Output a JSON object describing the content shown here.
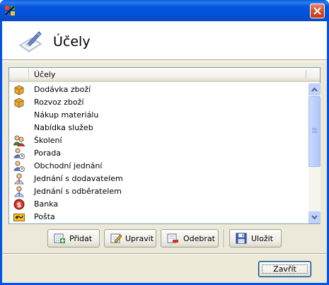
{
  "window": {
    "title": "",
    "close_icon": "close-icon"
  },
  "header": {
    "title": "Účely",
    "icon": "pencil-paper-icon"
  },
  "list": {
    "column": "Účely",
    "items": [
      {
        "label": "Dodávka zboží",
        "icon": "box-icon"
      },
      {
        "label": "Rozvoz zboží",
        "icon": "box-icon"
      },
      {
        "label": "Nákup materiálu",
        "icon": ""
      },
      {
        "label": "Nabídka služeb",
        "icon": ""
      },
      {
        "label": "Školení",
        "icon": "people-icon"
      },
      {
        "label": "Porada",
        "icon": "meeting-icon"
      },
      {
        "label": "Obchodní jednání",
        "icon": "meeting-icon"
      },
      {
        "label": "Jednání s dodavatelem",
        "icon": "person-icon"
      },
      {
        "label": "Jednání s odběratelem",
        "icon": "person-icon"
      },
      {
        "label": "Banka",
        "icon": "bank-dollar-icon"
      },
      {
        "label": "Pošta",
        "icon": "post-horn-icon"
      }
    ]
  },
  "toolbar": {
    "add_label": "Přidat",
    "edit_label": "Upravit",
    "remove_label": "Odebrat",
    "save_label": "Uložit"
  },
  "footer": {
    "close_label": "Zavřít"
  },
  "colors": {
    "title_bar": "#0054e3",
    "face": "#ece9d8",
    "list_border": "#7f9db9"
  }
}
